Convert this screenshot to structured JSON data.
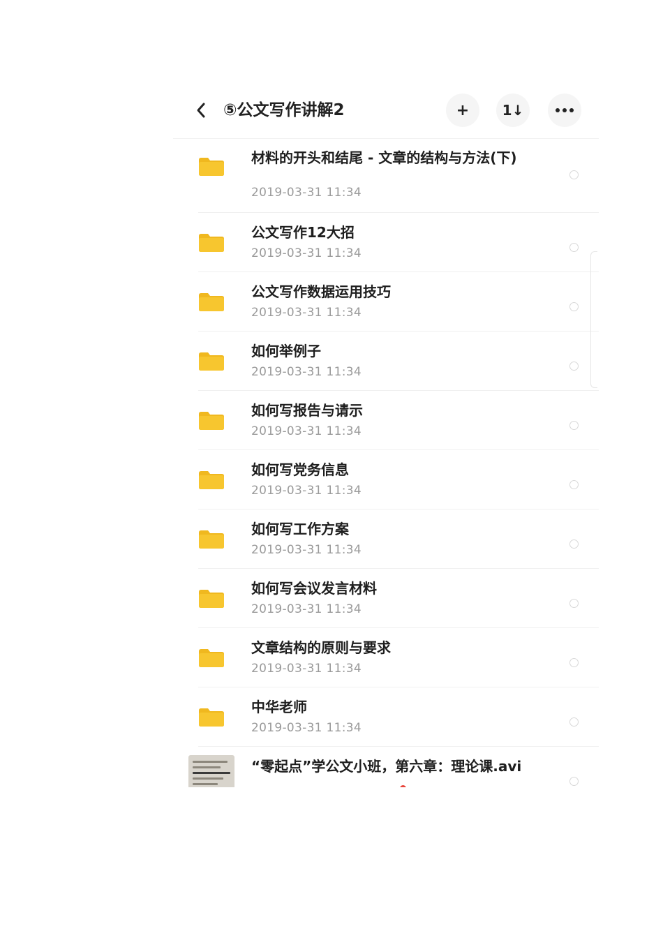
{
  "header": {
    "title": "⑤公文写作讲解2",
    "add_label": "+",
    "sort_label": "1↓"
  },
  "items": [
    {
      "name": "材料的开头和结尾 - 文章的结构与方法(下)",
      "date": "2019-03-31  11:34",
      "icon": "folder-icon"
    },
    {
      "name": "公文写作12大招",
      "date": "2019-03-31  11:34",
      "icon": "folder-icon"
    },
    {
      "name": "公文写作数据运用技巧",
      "date": "2019-03-31  11:34",
      "icon": "folder-icon"
    },
    {
      "name": "如何举例子",
      "date": "2019-03-31  11:34",
      "icon": "folder-icon"
    },
    {
      "name": "如何写报告与请示",
      "date": "2019-03-31  11:34",
      "icon": "folder-icon"
    },
    {
      "name": "如何写党务信息",
      "date": "2019-03-31  11:34",
      "icon": "folder-icon"
    },
    {
      "name": "如何写工作方案",
      "date": "2019-03-31  11:34",
      "icon": "folder-icon"
    },
    {
      "name": "如何写会议发言材料",
      "date": "2019-03-31  11:34",
      "icon": "folder-icon"
    },
    {
      "name": "文章结构的原则与要求",
      "date": "2019-03-31  11:34",
      "icon": "folder-icon"
    },
    {
      "name": "中华老师",
      "date": "2019-03-31  11:34",
      "icon": "folder-icon"
    }
  ],
  "partial_item": {
    "name": "“零起点”学公文小班，第六章：理论课.avi",
    "icon": "video-thumbnail"
  },
  "colors": {
    "folder": "#f7c62f",
    "folder_tab": "#f0b81f",
    "text_primary": "#1e1e1e",
    "text_secondary": "#9a9a9a"
  }
}
